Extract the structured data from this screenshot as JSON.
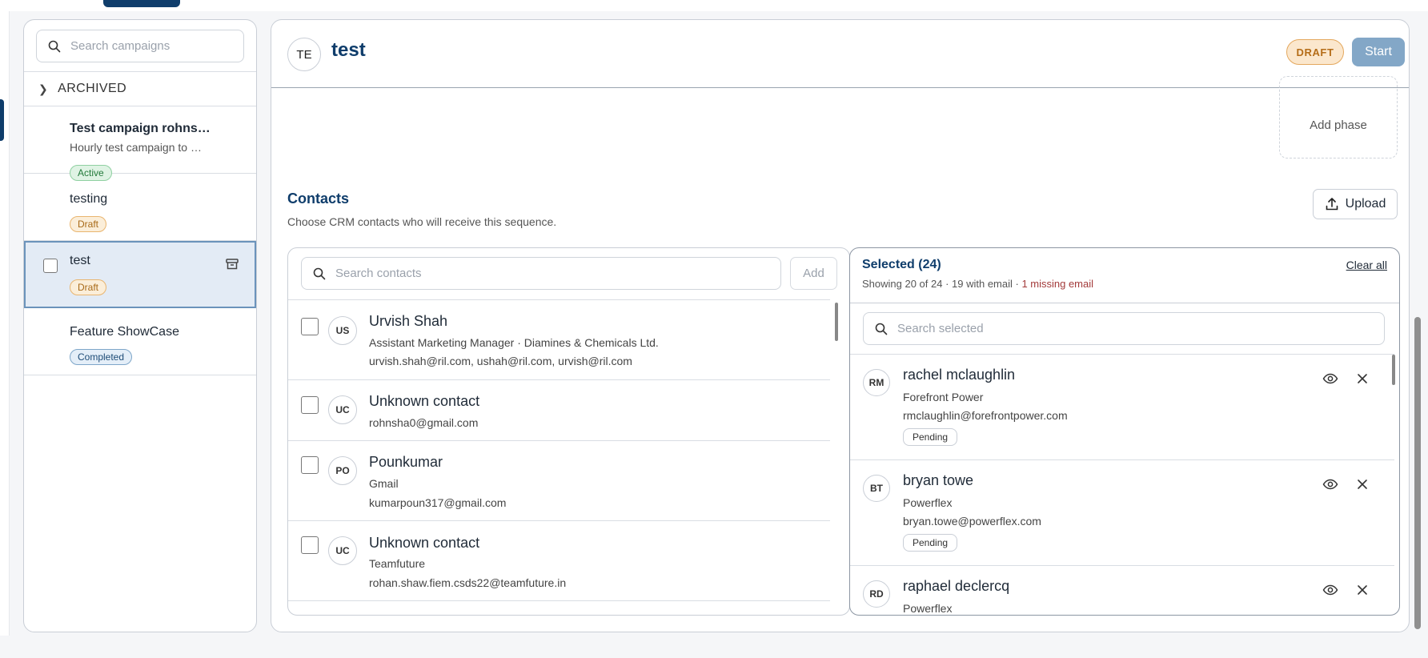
{
  "sidebar": {
    "search_placeholder": "Search campaigns",
    "archived_label": "ARCHIVED",
    "campaigns": [
      {
        "title": "Test campaign rohns…",
        "subtitle": "Hourly test campaign to …",
        "status": "Active"
      },
      {
        "title": "testing",
        "status": "Draft"
      },
      {
        "title": "test",
        "status": "Draft"
      },
      {
        "title": "Feature ShowCase",
        "status": "Completed"
      }
    ]
  },
  "header": {
    "avatar_initials": "TE",
    "title": "test",
    "status": "DRAFT",
    "start_label": "Start"
  },
  "phases": {
    "add_phase_label": "Add phase"
  },
  "contacts": {
    "title": "Contacts",
    "subtitle": "Choose CRM contacts who will receive this sequence.",
    "upload_label": "Upload",
    "search_placeholder": "Search contacts",
    "add_label": "Add",
    "list": [
      {
        "initials": "US",
        "name": "Urvish Shah",
        "line1": "Assistant Marketing Manager · Diamines & Chemicals Ltd.",
        "line2": "urvish.shah@ril.com, ushah@ril.com, urvish@ril.com"
      },
      {
        "initials": "UC",
        "name": "Unknown contact",
        "line1": "rohnsha0@gmail.com"
      },
      {
        "initials": "PO",
        "name": "Pounkumar",
        "line1": "Gmail",
        "line2": "kumarpoun317@gmail.com"
      },
      {
        "initials": "UC",
        "name": "Unknown contact",
        "line1": "Teamfuture",
        "line2": "rohan.shaw.fiem.csds22@teamfuture.in"
      }
    ]
  },
  "selected": {
    "title": "Selected (24)",
    "stats": "Showing 20 of 24 · 19 with email · ",
    "missing": "1 missing email",
    "clear_all": "Clear all",
    "search_placeholder": "Search selected",
    "list": [
      {
        "initials": "RM",
        "name": "rachel mclaughlin",
        "company": "Forefront Power",
        "email": "rmclaughlin@forefrontpower.com",
        "status": "Pending"
      },
      {
        "initials": "BT",
        "name": "bryan towe",
        "company": "Powerflex",
        "email": "bryan.towe@powerflex.com",
        "status": "Pending"
      },
      {
        "initials": "RD",
        "name": "raphael declercq",
        "company": "Powerflex"
      }
    ]
  },
  "colors": {
    "primary": "#0f3d6b",
    "active": "#237a3b",
    "draft": "#a86a18",
    "missing": "#a33a3a"
  }
}
